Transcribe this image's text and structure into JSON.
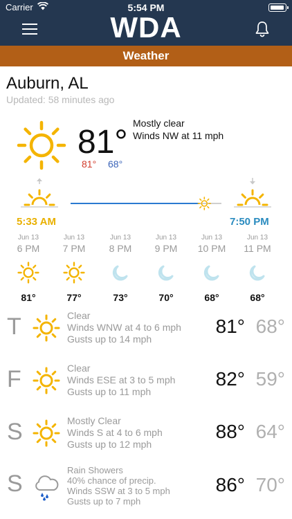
{
  "status_bar": {
    "carrier": "Carrier",
    "time": "5:54 PM"
  },
  "header": {
    "logo": "WDA",
    "section": "Weather"
  },
  "location": {
    "name": "Auburn, AL",
    "updated": "Updated: 58 minutes ago"
  },
  "current": {
    "icon": "sun-icon",
    "temp": "81°",
    "high": "81°",
    "low": "68°",
    "condition": "Mostly clear",
    "wind": "Winds NW at 11 mph",
    "high_color": "#d23b2b",
    "low_color": "#3a63b8"
  },
  "sun": {
    "sunrise": "5:33 AM",
    "sunset": "7:50 PM",
    "day_progress": 0.85,
    "sunrise_color": "#e9b000",
    "sunset_color": "#2a8bbf"
  },
  "hourly": [
    {
      "date": "Jun 13",
      "time": "6 PM",
      "icon": "sun-icon",
      "temp": "81°"
    },
    {
      "date": "Jun 13",
      "time": "7 PM",
      "icon": "sun-icon",
      "temp": "77°"
    },
    {
      "date": "Jun 13",
      "time": "8 PM",
      "icon": "moon-icon",
      "temp": "73°"
    },
    {
      "date": "Jun 13",
      "time": "9 PM",
      "icon": "moon-icon",
      "temp": "70°"
    },
    {
      "date": "Jun 13",
      "time": "10 PM",
      "icon": "moon-icon",
      "temp": "68°"
    },
    {
      "date": "Jun 13",
      "time": "11 PM",
      "icon": "moon-icon",
      "temp": "68°"
    }
  ],
  "daily": [
    {
      "day": "T",
      "icon": "sun-icon",
      "line1": "Clear",
      "line2": "Winds WNW at 4 to 6 mph",
      "line3": "Gusts up to 14 mph",
      "line4": "",
      "high": "81°",
      "low": "68°"
    },
    {
      "day": "F",
      "icon": "sun-icon",
      "line1": "Clear",
      "line2": "Winds ESE at 3 to 5 mph",
      "line3": "Gusts up to 11 mph",
      "line4": "",
      "high": "82°",
      "low": "59°"
    },
    {
      "day": "S",
      "icon": "sun-icon",
      "line1": "Mostly Clear",
      "line2": "Winds S at 4 to 6 mph",
      "line3": "Gusts up to 12 mph",
      "line4": "",
      "high": "88°",
      "low": "64°"
    },
    {
      "day": "S",
      "icon": "rain-icon",
      "line1": "Rain Showers",
      "line2": "40% chance of precip.",
      "line3": "Winds SSW at 3 to 5 mph",
      "line4": "Gusts up to 7 mph",
      "high": "86°",
      "low": "70°"
    }
  ],
  "colors": {
    "header_bg": "#243750",
    "section_bg": "#b25f17",
    "sun": "#f4b400",
    "moon": "#bfe3ee",
    "rain_drop": "#1f5fc9"
  }
}
